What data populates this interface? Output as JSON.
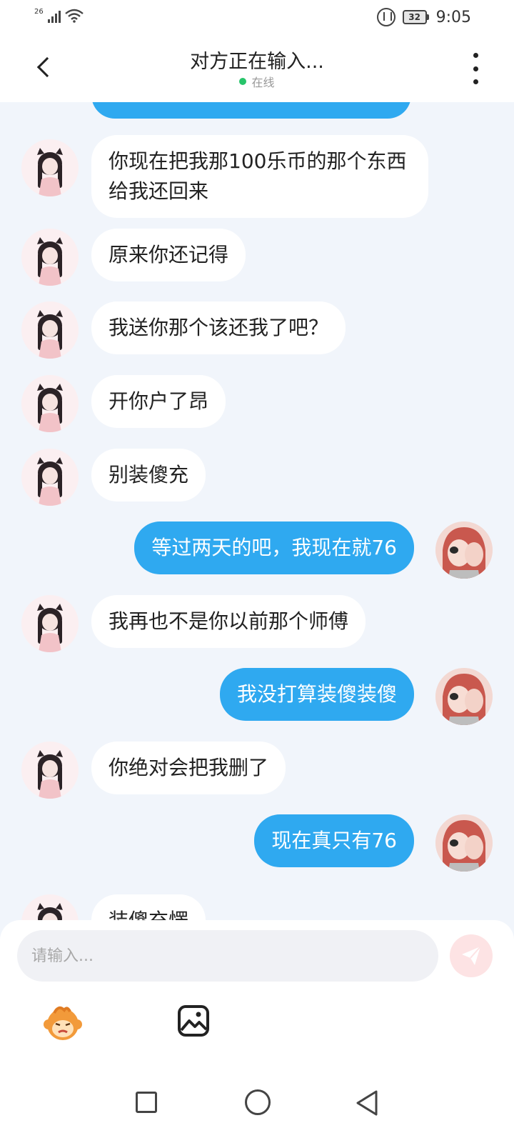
{
  "status_bar": {
    "network": "26",
    "battery": "32",
    "time": "9:05"
  },
  "header": {
    "title": "对方正在输入...",
    "status": "在线"
  },
  "messages": [
    {
      "side": "left",
      "text": "你现在把我那100乐币的那个东西给我还回来"
    },
    {
      "side": "left",
      "text": "原来你还记得"
    },
    {
      "side": "left",
      "text": "我送你那个该还我了吧？"
    },
    {
      "side": "left",
      "text": "开你户了昂"
    },
    {
      "side": "left",
      "text": "别装傻充"
    },
    {
      "side": "right",
      "text": "等过两天的吧，我现在就76"
    },
    {
      "side": "left",
      "text": "我再也不是你以前那个师傅"
    },
    {
      "side": "right",
      "text": "我没打算装傻装傻"
    },
    {
      "side": "left",
      "text": "你绝对会把我删了"
    },
    {
      "side": "right",
      "text": "现在真只有76"
    },
    {
      "side": "left",
      "text": "装傻充愣"
    }
  ],
  "composer": {
    "placeholder": "请输入..."
  },
  "colors": {
    "outgoing_bubble": "#2fa9f0",
    "incoming_bubble": "#ffffff",
    "background": "#f1f5fb",
    "online_dot": "#27c46a"
  },
  "icons": {
    "back": "chevron-left-icon",
    "more": "more-vertical-icon",
    "send": "send-icon",
    "emoji": "monkey-emoji-icon",
    "image": "image-icon"
  }
}
